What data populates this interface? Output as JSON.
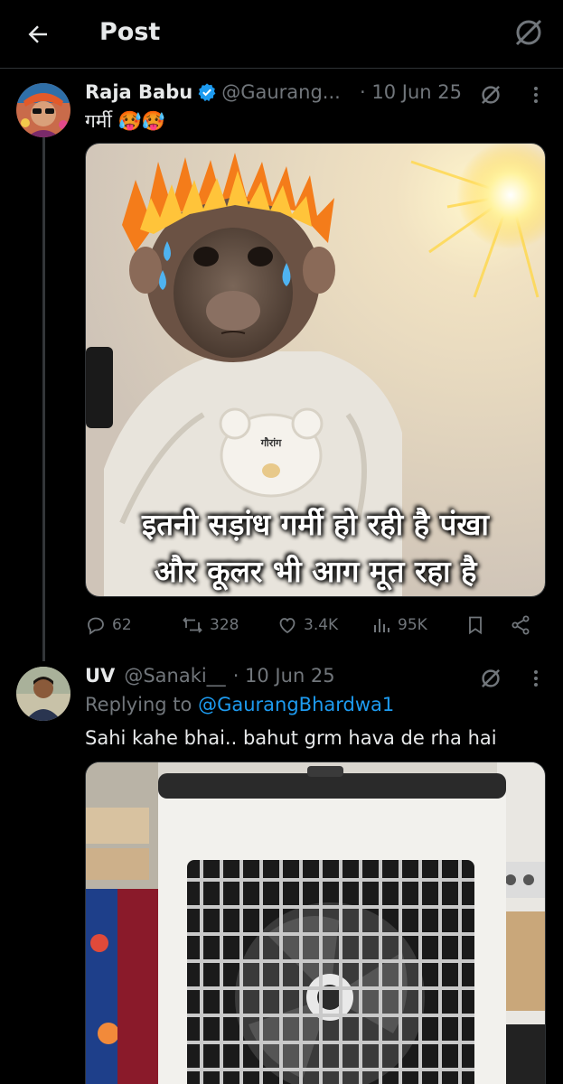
{
  "header": {
    "title": "Post"
  },
  "main_post": {
    "display_name": "Raja Babu",
    "handle": "@Gaurang...",
    "date": "· 10 Jun 25",
    "text": "गर्मी 🥵🥵",
    "meme_caption_line1": "इतनी सड़ांध गर्मी हो रही है पंखा",
    "meme_caption_line2": "और कूलर भी आग मूत रहा है",
    "shirt_text": "गौरांग",
    "stats": {
      "replies": "62",
      "reposts": "328",
      "likes": "3.4K",
      "views": "95K"
    }
  },
  "reply_post": {
    "display_name": "UV",
    "handle": "@Sanaki__",
    "date": "· 10 Jun 25",
    "replying_to_label": "Replying to",
    "replying_to_handle": "@GaurangBhardwa1",
    "text": "Sahi kahe bhai.. bahut grm hava de rha hai"
  },
  "icons": {
    "back": "arrow-left-icon",
    "grok": "grok-icon",
    "verified": "verified-badge-icon",
    "more": "more-vertical-icon",
    "reply": "reply-icon",
    "repost": "repost-icon",
    "like": "heart-icon",
    "views": "views-icon",
    "bookmark": "bookmark-icon",
    "share": "share-icon"
  },
  "colors": {
    "background": "#000000",
    "text": "#e7e9ea",
    "muted": "#71767b",
    "accent": "#1d9bf0",
    "divider": "#2f3336"
  }
}
